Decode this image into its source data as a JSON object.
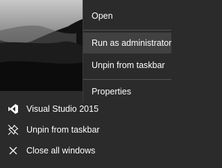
{
  "context_menu": {
    "items": [
      {
        "label": "Open"
      },
      {
        "label": "Run as administrator"
      },
      {
        "label": "Unpin from taskbar"
      },
      {
        "label": "Properties"
      }
    ]
  },
  "jump_list": {
    "items": [
      {
        "label": "Visual Studio 2015",
        "icon": "visual-studio-icon"
      },
      {
        "label": "Unpin from taskbar",
        "icon": "unpin-icon"
      },
      {
        "label": "Close all windows",
        "icon": "close-icon"
      }
    ]
  },
  "colors": {
    "menu_background": "#2b2b2b",
    "menu_hover": "#414141",
    "text": "#ffffff",
    "separator": "#555555"
  }
}
